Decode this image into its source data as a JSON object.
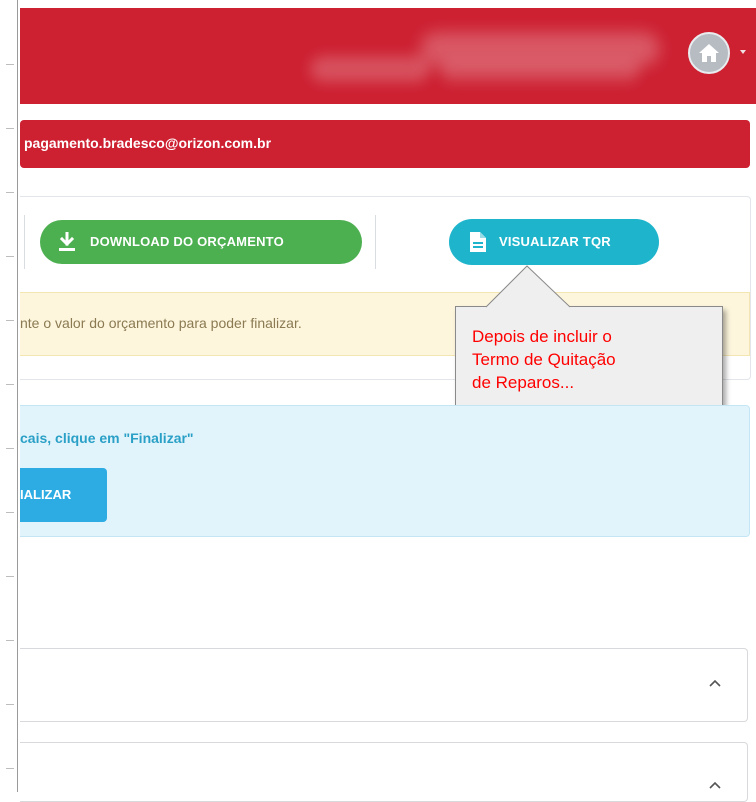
{
  "header": {
    "user_area": "",
    "avatar_icon": "home-icon"
  },
  "email_bar": {
    "text": "pagamento.bradesco@orizon.com.br"
  },
  "actions": {
    "download_label": "DOWNLOAD DO ORÇAMENTO",
    "download_icon": "download-icon",
    "tqr_label": "VISUALIZAR TQR",
    "tqr_icon": "document-icon",
    "warning_text": "nte o valor do orçamento para poder finalizar."
  },
  "tooltip": {
    "text": "Depois de incluir o\nTermo de Quitação\nde Reparos..."
  },
  "info": {
    "text": "cais, clique em \"Finalizar\"",
    "finalize_label": "IALIZAR"
  },
  "accordions": [
    {
      "chevron": "chevron-up-icon"
    },
    {
      "chevron": "chevron-up-icon"
    }
  ],
  "colors": {
    "header_red": "#cd2031",
    "download_green": "#4caf50",
    "tqr_teal": "#1eb5cc",
    "finalize_blue": "#2cace3",
    "info_bg": "#e2f4fb",
    "warning_bg": "#fdf6dd",
    "tooltip_text": "#ff0000"
  }
}
